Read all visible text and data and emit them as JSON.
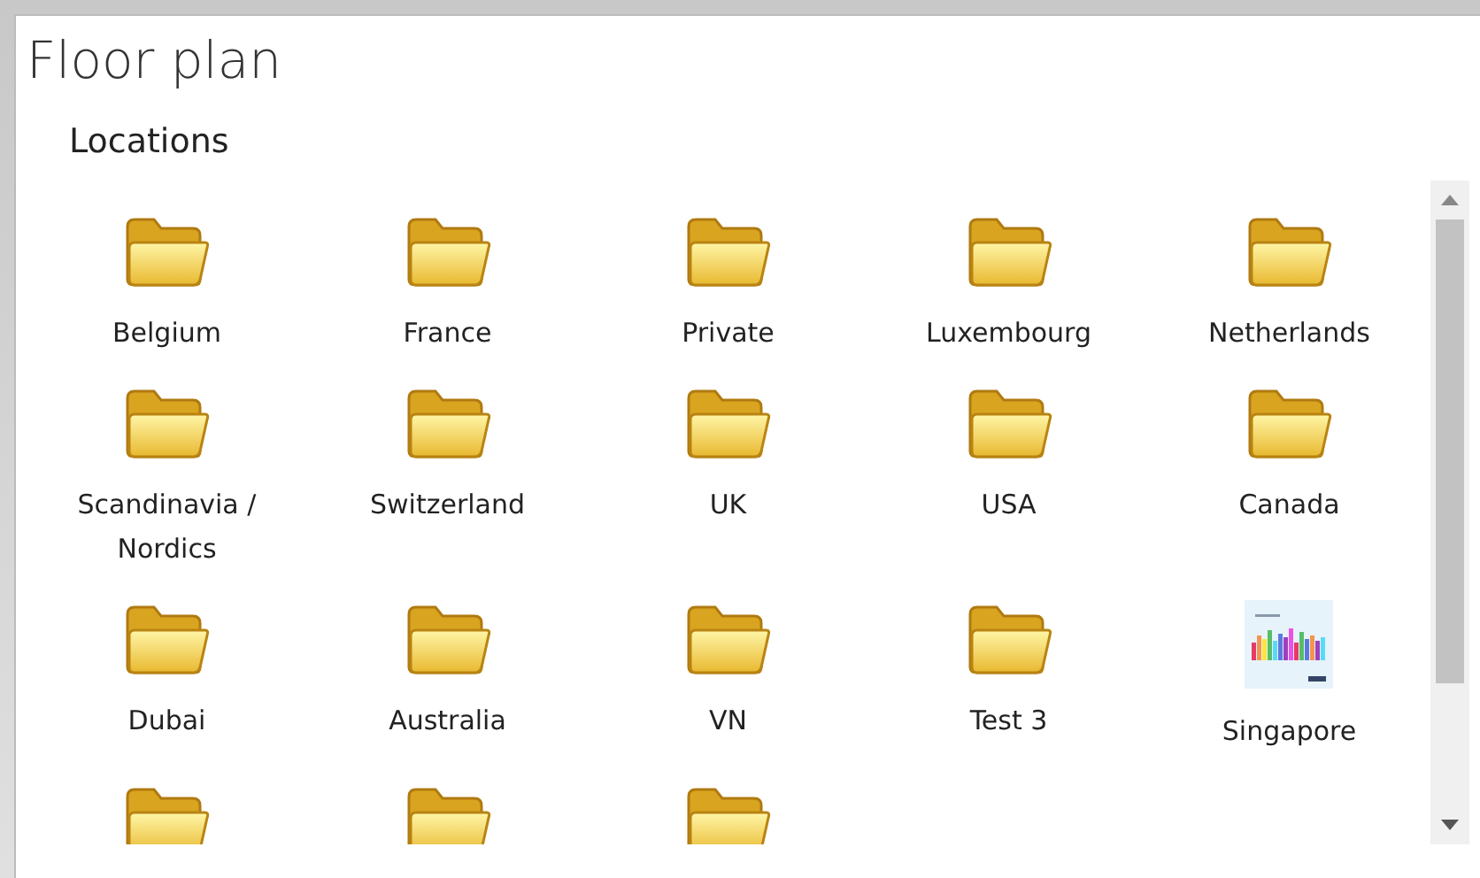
{
  "window": {
    "title": "Floor plan"
  },
  "section": {
    "title": "Locations"
  },
  "items": [
    {
      "kind": "folder",
      "label": "Belgium"
    },
    {
      "kind": "folder",
      "label": "France"
    },
    {
      "kind": "folder",
      "label": "Private"
    },
    {
      "kind": "folder",
      "label": "Luxembourg"
    },
    {
      "kind": "folder",
      "label": "Netherlands"
    },
    {
      "kind": "folder",
      "label": "Scandinavia / Nordics"
    },
    {
      "kind": "folder",
      "label": "Switzerland"
    },
    {
      "kind": "folder",
      "label": "UK"
    },
    {
      "kind": "folder",
      "label": "USA"
    },
    {
      "kind": "folder",
      "label": "Canada"
    },
    {
      "kind": "folder",
      "label": "Dubai"
    },
    {
      "kind": "folder",
      "label": "Australia"
    },
    {
      "kind": "folder",
      "label": "VN"
    },
    {
      "kind": "folder",
      "label": "Test 3"
    },
    {
      "kind": "image",
      "label": "Singapore"
    },
    {
      "kind": "folder"
    },
    {
      "kind": "folder"
    },
    {
      "kind": "folder"
    }
  ]
}
